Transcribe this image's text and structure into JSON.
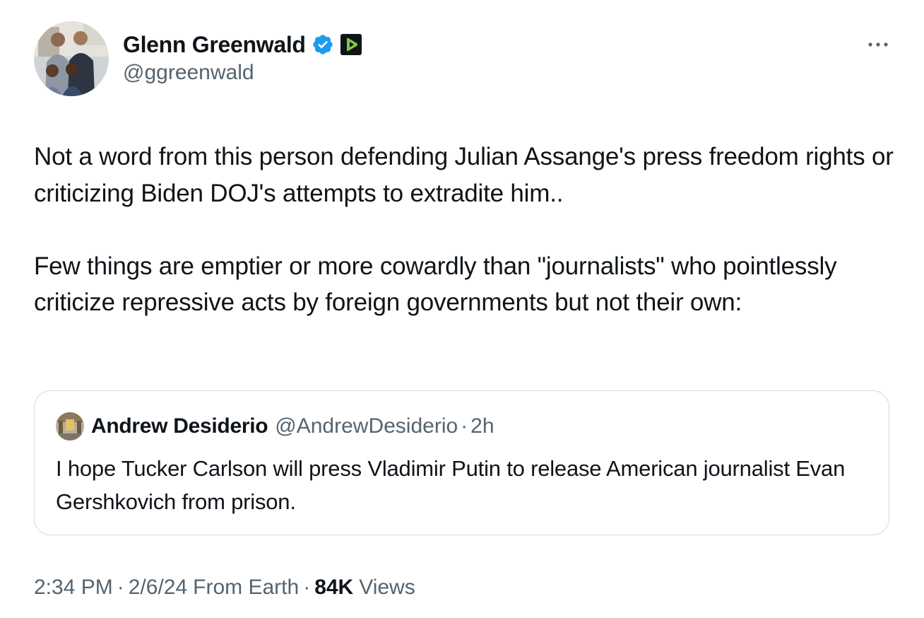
{
  "author": {
    "name": "Glenn Greenwald",
    "handle": "@ggreenwald",
    "avatar_icon": "profile-photo-family",
    "verified_icon": "verified-badge-icon",
    "affiliate_icon": "rumble-badge-icon"
  },
  "more_icon": "more-dots-icon",
  "tweet": {
    "paragraphs": [
      "Not a word from this person defending Julian Assange's press freedom rights or criticizing Biden DOJ's attempts to extradite him..",
      "Few things are emptier or more cowardly than \"journalists\" who pointlessly criticize repressive acts by foreign governments but not their own:"
    ]
  },
  "quote": {
    "name": "Andrew Desiderio",
    "handle": "@AndrewDesiderio",
    "separator": "·",
    "time": "2h",
    "text": "I hope Tucker Carlson will press Vladimir Putin to release American journalist Evan Gershkovich from prison."
  },
  "meta": {
    "time": "2:34 PM",
    "separator": "·",
    "date": "2/6/24",
    "location": "From Earth",
    "views_count": "84K",
    "views_label": "Views"
  },
  "colors": {
    "text_primary": "#0f1419",
    "text_secondary": "#536471",
    "verified_blue": "#1d9bf0",
    "border": "#cfd9de",
    "rumble_green": "#85c742"
  }
}
